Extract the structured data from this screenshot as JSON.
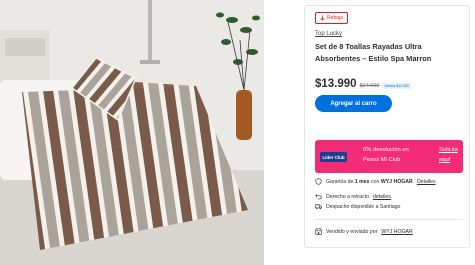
{
  "badge": {
    "label": "Rebaja"
  },
  "product": {
    "brand": "Top Lucky",
    "title": "Set de 8 Toallas Rayadas Ultra Absorbentes – Estilo Spa Marron",
    "price": "$13.990",
    "old_price": "$24.990",
    "savings_tag": "Ahorra $11.000"
  },
  "actions": {
    "add_to_cart": "Agregar al carro"
  },
  "club": {
    "logo_text": "Líder Club",
    "line1": "6% devolución en",
    "line2": "Pesos Mi Club",
    "link1": "Solicita",
    "link2": "aquí"
  },
  "info": {
    "warranty_prefix": "Garantía de ",
    "warranty_months": "1 mes",
    "warranty_middle": " con ",
    "warranty_brand": "WYJ HOGAR",
    "warranty_link": "Detalles",
    "return_text": "Derecho a retracto",
    "return_link": "detalles",
    "shipping_text": "Despacho disponible a Santiago",
    "seller_text": "Vendido y enviado por",
    "seller_link": "WYJ HOGAR"
  },
  "colors": {
    "accent_blue": "#0071dc",
    "club_pink": "#f22d76",
    "sale_red": "#de1c24"
  }
}
